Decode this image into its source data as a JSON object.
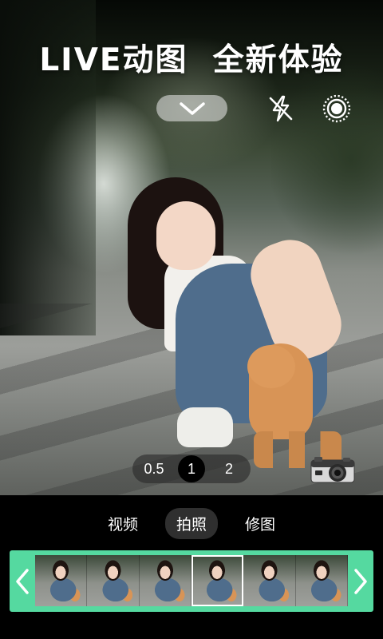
{
  "headline": "LIVE动图  全新体验",
  "top_controls": {
    "collapse_icon": "chevron-down-icon",
    "flash_icon": "flash-off-icon",
    "live_icon": "live-photo-icon"
  },
  "zoom": {
    "options": [
      "0.5",
      "1",
      "2"
    ],
    "selected": "1"
  },
  "camera_icon": "camera-icon",
  "modes": {
    "tabs": [
      "视频",
      "拍照",
      "修图"
    ],
    "selected": "拍照"
  },
  "filmstrip": {
    "prev_icon": "chevron-left-icon",
    "next_icon": "chevron-right-icon",
    "frame_count": 6,
    "current_frame": 3,
    "accent_color": "#55d9a0"
  }
}
